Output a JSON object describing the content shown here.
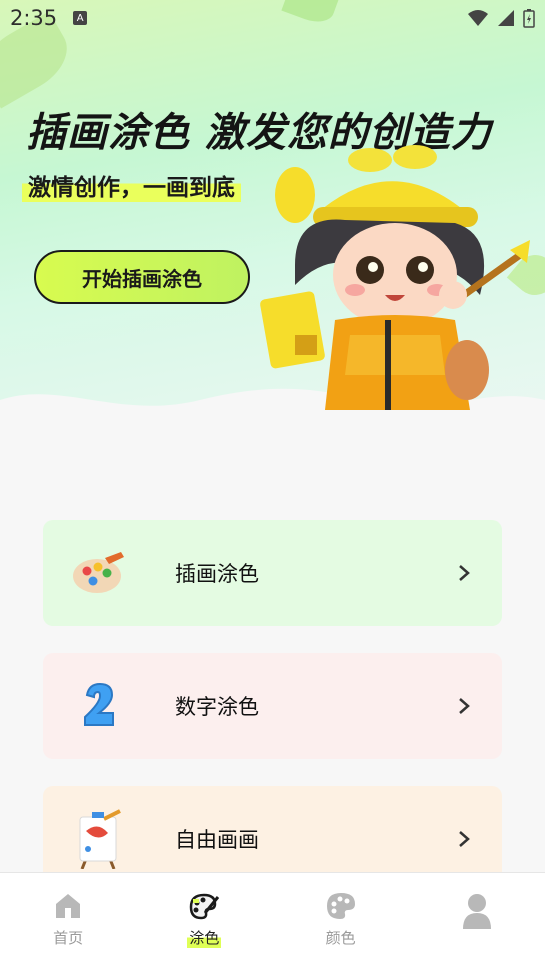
{
  "status_bar": {
    "time": "2:35",
    "notification_letter": "A"
  },
  "hero": {
    "title": "插画涂色 激发您的创造力",
    "subtitle": "激情创作，一画到底",
    "cta_label": "开始插画涂色"
  },
  "cards": [
    {
      "label": "插画涂色",
      "icon": "palette-icon"
    },
    {
      "label": "数字涂色",
      "icon": "number-two-icon"
    },
    {
      "label": "自由画画",
      "icon": "easel-icon"
    }
  ],
  "tabs": [
    {
      "label": "首页",
      "icon": "home-icon",
      "active": false
    },
    {
      "label": "涂色",
      "icon": "palette-brush-icon",
      "active": true
    },
    {
      "label": "颜色",
      "icon": "palette-icon",
      "active": false
    },
    {
      "label": "",
      "icon": "profile-icon",
      "active": false
    }
  ],
  "colors": {
    "accent": "#dfff56",
    "card1_bg": "#e4fbe2",
    "card2_bg": "#fcefee",
    "card3_bg": "#fdf1e3"
  }
}
